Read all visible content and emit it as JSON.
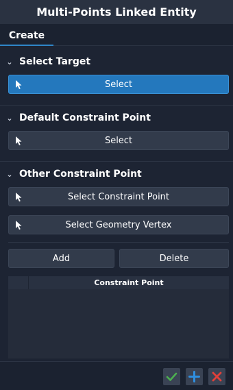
{
  "window": {
    "title": "Multi-Points Linked Entity"
  },
  "tabs": [
    {
      "label": "Create",
      "active": true
    }
  ],
  "sections": {
    "select_target": {
      "title": "Select Target",
      "button_label": "Select",
      "button_active": true
    },
    "default_constraint_point": {
      "title": "Default Constraint Point",
      "button_label": "Select"
    },
    "other_constraint_point": {
      "title": "Other Constraint Point",
      "select_constraint_point_label": "Select Constraint Point",
      "select_geometry_vertex_label": "Select Geometry Vertex",
      "add_label": "Add",
      "delete_label": "Delete",
      "table": {
        "columns": [
          "Constraint Point"
        ],
        "rows": []
      }
    }
  },
  "footer": {
    "confirm_icon": "check-icon",
    "apply_icon": "plus-icon",
    "cancel_icon": "close-icon"
  },
  "colors": {
    "accent": "#2478bd",
    "confirm": "#4caf50",
    "apply": "#2f8fe0",
    "cancel": "#e0403a"
  }
}
